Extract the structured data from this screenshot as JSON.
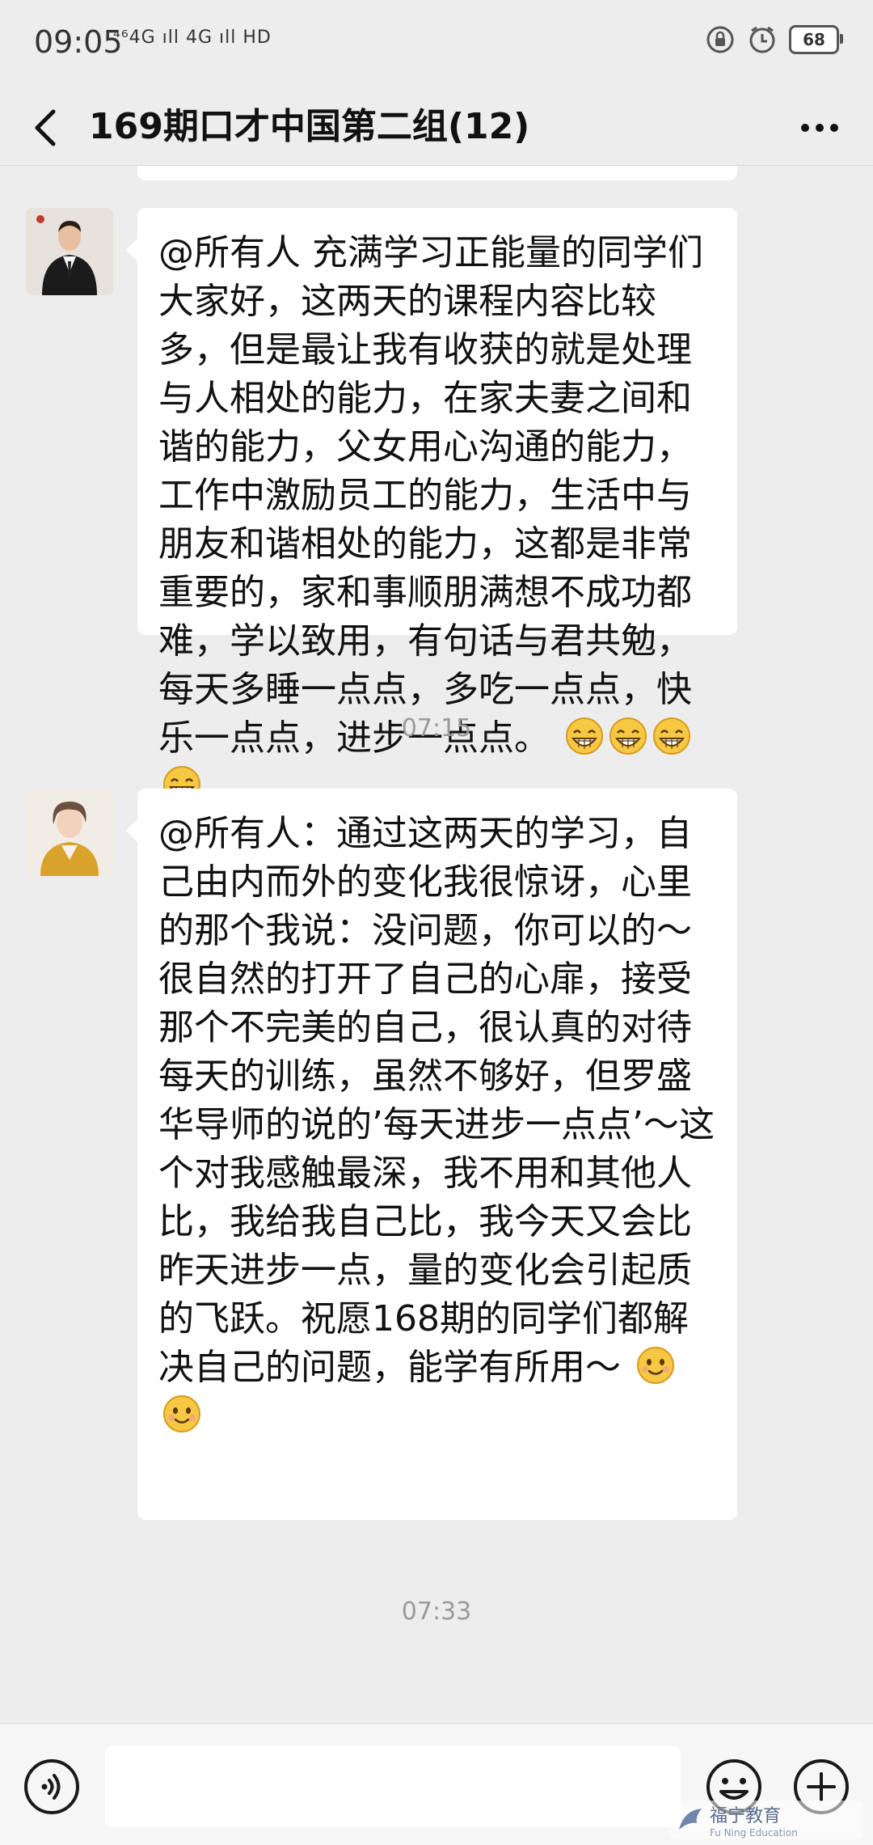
{
  "status_bar": {
    "time": "09:05",
    "network": "⁴⁶4G ıll 4G ıll HD",
    "battery": "68"
  },
  "header": {
    "title": "169期口才中国第二组(12)"
  },
  "messages": [
    {
      "text": "@所有人 充满学习正能量的同学们大家好，这两天的课程内容比较多，但是最让我有收获的就是处理与人相处的能力，在家夫妻之间和谐的能力，父女用心沟通的能力，工作中激励员工的能力，生活中与朋友和谐相处的能力，这都是非常重要的，家和事顺朋满想不成功都难，学以致用，有句话与君共勉，每天多睡一点点，多吃一点点，快乐一点点，进步一点点。",
      "emojis": [
        "grin-emoji",
        "grin-emoji",
        "grin-emoji",
        "grin-emoji"
      ]
    },
    {
      "text": "@所有人：通过这两天的学习，自己由内而外的变化我很惊讶，心里的那个我说：没问题，你可以的～很自然的打开了自己的心扉，接受那个不完美的自己，很认真的对待每天的训练，虽然不够好，但罗盛华导师的说的’每天进步一点点’～这个对我感触最深，我不用和其他人比，我给我自己比，我今天又会比昨天进步一点，量的变化会引起质的飞跃。祝愿168期的同学们都解决自己的问题，能学有所用～",
      "emojis": [
        "smile-emoji",
        "smile-emoji"
      ]
    }
  ],
  "timestamps": [
    "07:15",
    "07:33"
  ],
  "watermark": {
    "text": "福宁教育",
    "sub": "Fu Ning Education"
  },
  "colors": {
    "background": "#ededed",
    "bubble": "#ffffff",
    "timestamp": "#9a9a9a"
  }
}
